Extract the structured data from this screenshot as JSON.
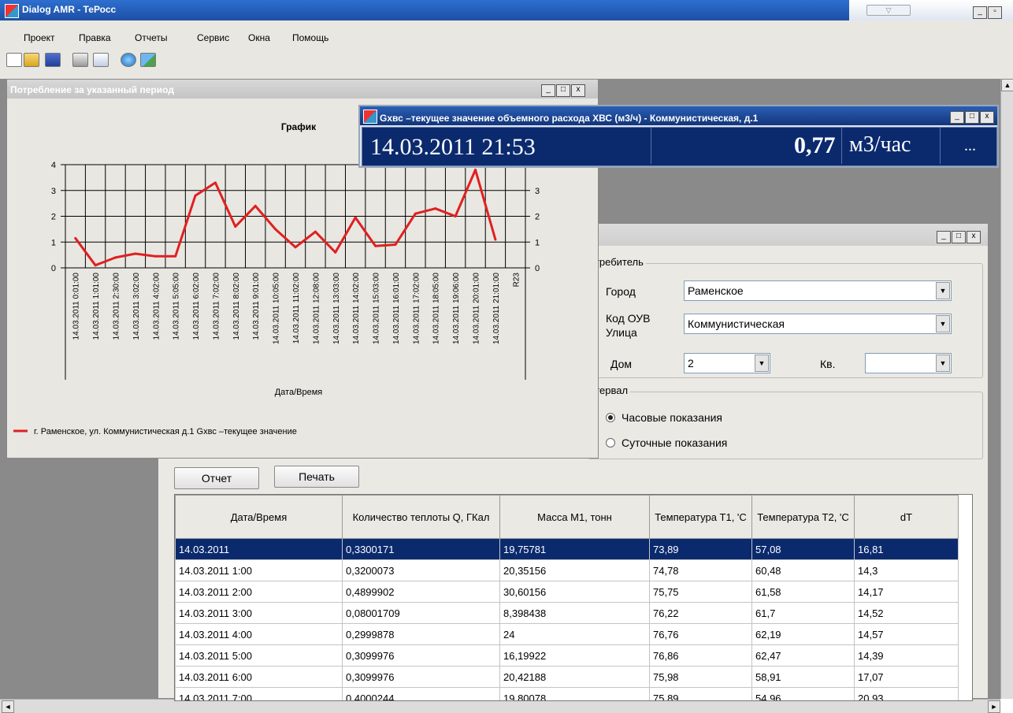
{
  "window": {
    "title": "Dialog AMR - ТеРосс"
  },
  "menu": [
    "Проект",
    "Правка",
    "Отчеты",
    "Сервис",
    "Окна",
    "Помощь"
  ],
  "toolbar_icons": [
    "new-icon",
    "open-icon",
    "save-icon",
    "print-icon",
    "print-preview-icon",
    "globe-icon",
    "image-icon"
  ],
  "chart_window": {
    "title": "Потребление за указанный период"
  },
  "chart_data": {
    "type": "line",
    "title": "График",
    "xlabel": "Дата/Время",
    "ylabel": "",
    "ylim": [
      0,
      4
    ],
    "yticks": [
      0,
      1,
      2,
      3,
      4
    ],
    "categories": [
      "14.03.2011 0:01:00",
      "14.03.2011 1:01:00",
      "14.03.2011 2:30:00",
      "14.03.2011 3:02:00",
      "14.03.2011 4:02:00",
      "14.03.2011 5:05:00",
      "14.03.2011 6:02:00",
      "14.03.2011 7:02:00",
      "14.03.2011 8:02:00",
      "14.03.2011 9:01:00",
      "14.03.2011 10:05:00",
      "14.03.2011 11:02:00",
      "14.03.2011 12:08:00",
      "14.03.2011 13:03:00",
      "14.03.2011 14:02:00",
      "14.03.2011 15:03:00",
      "14.03.2011 16:01:00",
      "14.03.2011 17:02:00",
      "14.03.2011 18:05:00",
      "14.03.2011 19:06:00",
      "14.03.2011 20:01:00",
      "14.03.2011 21:01:00",
      "R23"
    ],
    "series": [
      {
        "name": "г. Раменское, ул. Коммунистическая д.1 Gхвс –текущее значение",
        "color": "#e02020",
        "values": [
          1.15,
          0.1,
          0.4,
          0.55,
          0.45,
          0.45,
          2.8,
          3.3,
          1.6,
          2.4,
          1.5,
          0.8,
          1.4,
          0.6,
          1.95,
          0.85,
          0.9,
          2.1,
          2.3,
          2.0,
          3.8,
          1.1
        ]
      }
    ],
    "legend": "bottom-left"
  },
  "gxvs_window": {
    "title": "Gхвс –текущее значение объемного расхода ХВС (м3/ч) - Коммунистическая, д.1",
    "datetime": "14.03.2011 21:53",
    "value": "0,77",
    "unit": "м3/час",
    "more": "..."
  },
  "report_window": {
    "consumer_group": "отребитель",
    "city_label": "Город",
    "city_value": "Раменское",
    "street_label": "Код ОУВ\nУлица",
    "street_value": "Коммунистическая",
    "house_label": "Дом",
    "house_value": "2",
    "apt_label": "Кв.",
    "apt_value": "",
    "interval_group": "нтервал",
    "radio_hourly": "Часовые показания",
    "radio_daily": "Суточные показания",
    "report_button": "Отчет",
    "print_button": "Печать"
  },
  "table": {
    "headers": [
      "Дата/Время",
      "Количество теплоты Q, ГКал",
      "Масса  М1, тонн",
      "Температура Т1, 'C",
      "Температура Т2, 'C",
      "dT"
    ],
    "rows": [
      [
        "14.03.2011",
        "0,3300171",
        "19,75781",
        "73,89",
        "57,08",
        "16,81"
      ],
      [
        "14.03.2011 1:00",
        "0,3200073",
        "20,35156",
        "74,78",
        "60,48",
        "14,3"
      ],
      [
        "14.03.2011 2:00",
        "0,4899902",
        "30,60156",
        "75,75",
        "61,58",
        "14,17"
      ],
      [
        "14.03.2011 3:00",
        "0,08001709",
        "8,398438",
        "76,22",
        "61,7",
        "14,52"
      ],
      [
        "14.03.2011 4:00",
        "0,2999878",
        "24",
        "76,76",
        "62,19",
        "14,57"
      ],
      [
        "14.03.2011 5:00",
        "0,3099976",
        "16,19922",
        "76,86",
        "62,47",
        "14,39"
      ],
      [
        "14.03.2011 6:00",
        "0,3099976",
        "20,42188",
        "75,98",
        "58,91",
        "17,07"
      ],
      [
        "14.03.2011 7:00",
        "0,4000244",
        "19,80078",
        "75,89",
        "54,96",
        "20,93"
      ]
    ],
    "selected_row": 0
  }
}
